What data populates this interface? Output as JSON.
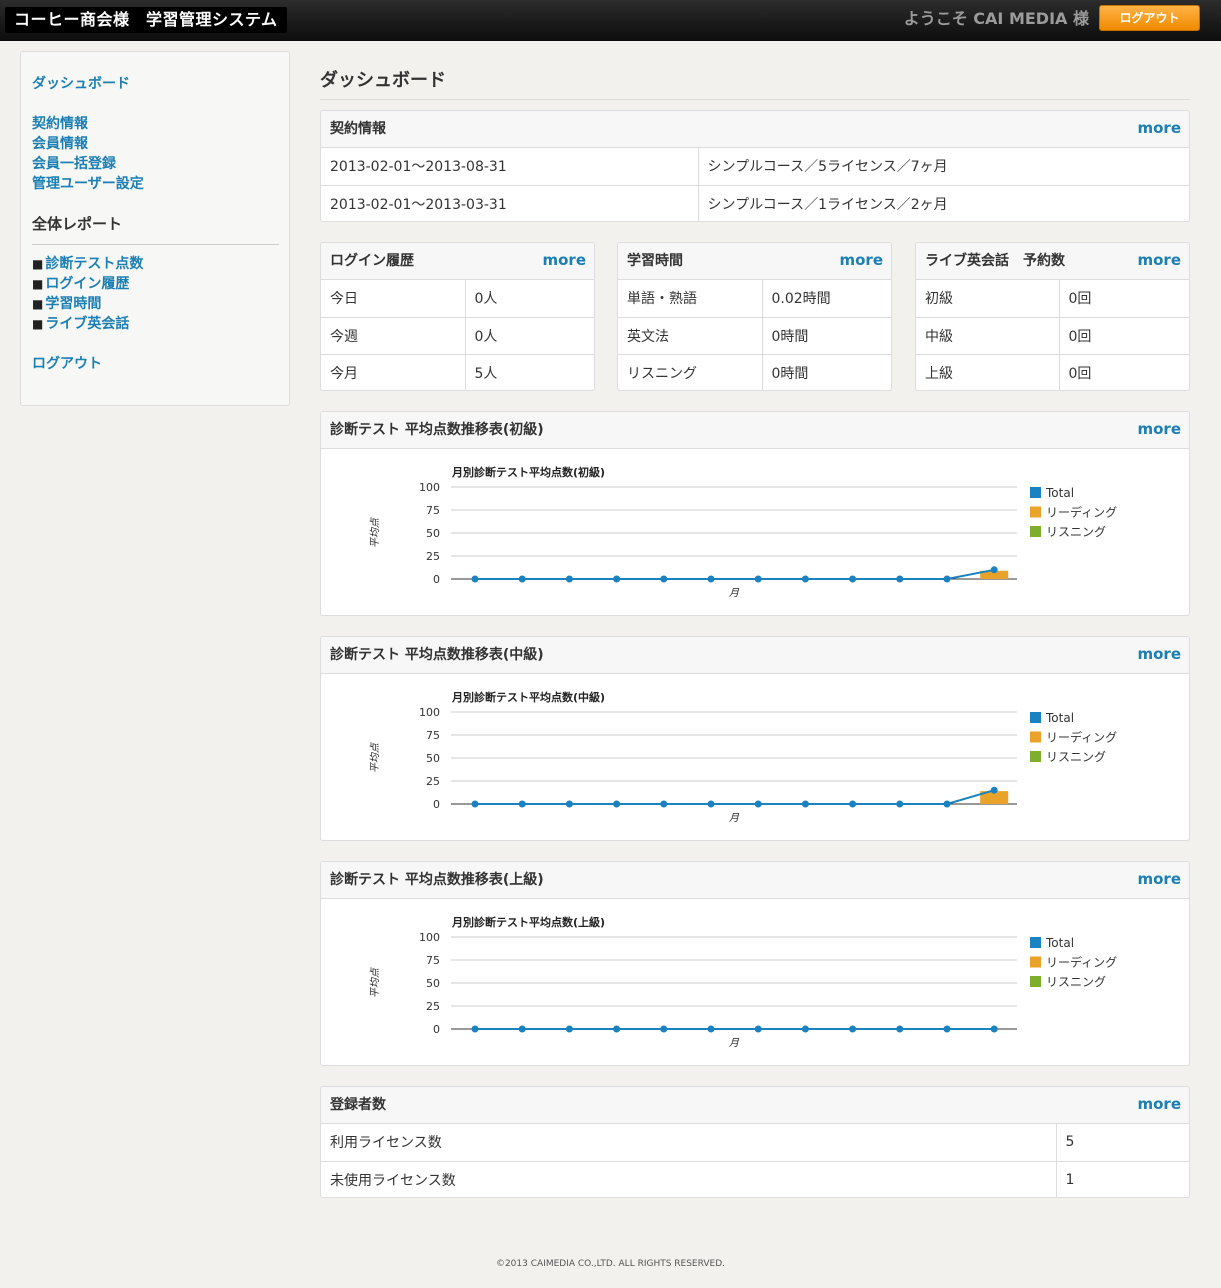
{
  "header": {
    "brand": "コーヒー商会様　学習管理システム",
    "welcome": "ようこそ CAI MEDIA 様",
    "logout_button": "ログアウト"
  },
  "sidebar": {
    "dashboard": "ダッシュボード",
    "links": [
      "契約情報",
      "会員情報",
      "会員一括登録",
      "管理ユーザー設定"
    ],
    "report_heading": "全体レポート",
    "bullet": "■",
    "reports": [
      "診断テスト点数",
      "ログイン履歴",
      "学習時間",
      "ライブ英会話"
    ],
    "logout": "ログアウト"
  },
  "main": {
    "title": "ダッシュボード",
    "more": "more",
    "contract": {
      "title": "契約情報",
      "rows": [
        [
          "2013-02-01～2013-08-31",
          "シンプルコース／5ライセンス／7ヶ月"
        ],
        [
          "2013-02-01～2013-03-31",
          "シンプルコース／1ライセンス／2ヶ月"
        ]
      ]
    },
    "login_history": {
      "title": "ログイン履歴",
      "rows": [
        [
          "今日",
          "0人"
        ],
        [
          "今週",
          "0人"
        ],
        [
          "今月",
          "5人"
        ]
      ]
    },
    "study_time": {
      "title": "学習時間",
      "rows": [
        [
          "単語・熟語",
          "0.02時間"
        ],
        [
          "英文法",
          "0時間"
        ],
        [
          "リスニング",
          "0時間"
        ]
      ]
    },
    "live_english": {
      "title": "ライブ英会話　予約数",
      "rows": [
        [
          "初級",
          "0回"
        ],
        [
          "中級",
          "0回"
        ],
        [
          "上級",
          "0回"
        ]
      ]
    },
    "registrations": {
      "title": "登録者数",
      "rows": [
        [
          "利用ライセンス数",
          "5"
        ],
        [
          "未使用ライセンス数",
          "1"
        ]
      ]
    }
  },
  "chart_panels": [
    {
      "panel_title": "診断テスト 平均点数推移表(初級)"
    },
    {
      "panel_title": "診断テスト 平均点数推移表(中級)"
    },
    {
      "panel_title": "診断テスト 平均点数推移表(上級)"
    }
  ],
  "chart_data": [
    {
      "type": "line",
      "title": "月別診断テスト平均点数(初級)",
      "xlabel": "月",
      "ylabel": "平均点",
      "ylim": [
        0,
        100
      ],
      "yticks": [
        0,
        25,
        50,
        75,
        100
      ],
      "grid": true,
      "legend_position": "right",
      "series": [
        {
          "name": "Total",
          "kind": "line",
          "color": "#1a82c0",
          "values": [
            0,
            0,
            0,
            0,
            0,
            0,
            0,
            0,
            0,
            0,
            0,
            10
          ]
        },
        {
          "name": "リーディング",
          "kind": "bar",
          "color": "#e9a32a",
          "values": [
            0,
            0,
            0,
            0,
            0,
            0,
            0,
            0,
            0,
            0,
            0,
            9
          ]
        },
        {
          "name": "リスニング",
          "kind": "bar",
          "color": "#7fae2e",
          "values": [
            0,
            0,
            0,
            0,
            0,
            0,
            0,
            0,
            0,
            0,
            0,
            0
          ]
        }
      ]
    },
    {
      "type": "line",
      "title": "月別診断テスト平均点数(中級)",
      "xlabel": "月",
      "ylabel": "平均点",
      "ylim": [
        0,
        100
      ],
      "yticks": [
        0,
        25,
        50,
        75,
        100
      ],
      "grid": true,
      "legend_position": "right",
      "series": [
        {
          "name": "Total",
          "kind": "line",
          "color": "#1a82c0",
          "values": [
            0,
            0,
            0,
            0,
            0,
            0,
            0,
            0,
            0,
            0,
            0,
            15
          ]
        },
        {
          "name": "リーディング",
          "kind": "bar",
          "color": "#e9a32a",
          "values": [
            0,
            0,
            0,
            0,
            0,
            0,
            0,
            0,
            0,
            0,
            0,
            14
          ]
        },
        {
          "name": "リスニング",
          "kind": "bar",
          "color": "#7fae2e",
          "values": [
            0,
            0,
            0,
            0,
            0,
            0,
            0,
            0,
            0,
            0,
            0,
            0
          ]
        }
      ]
    },
    {
      "type": "line",
      "title": "月別診断テスト平均点数(上級)",
      "xlabel": "月",
      "ylabel": "平均点",
      "ylim": [
        0,
        100
      ],
      "yticks": [
        0,
        25,
        50,
        75,
        100
      ],
      "grid": true,
      "legend_position": "right",
      "series": [
        {
          "name": "Total",
          "kind": "line",
          "color": "#1a82c0",
          "values": [
            0,
            0,
            0,
            0,
            0,
            0,
            0,
            0,
            0,
            0,
            0,
            0
          ]
        },
        {
          "name": "リーディング",
          "kind": "bar",
          "color": "#e9a32a",
          "values": [
            0,
            0,
            0,
            0,
            0,
            0,
            0,
            0,
            0,
            0,
            0,
            0
          ]
        },
        {
          "name": "リスニング",
          "kind": "bar",
          "color": "#7fae2e",
          "values": [
            0,
            0,
            0,
            0,
            0,
            0,
            0,
            0,
            0,
            0,
            0,
            0
          ]
        }
      ]
    }
  ],
  "footer": "©2013 CAIMEDIA CO.,LTD. ALL RIGHTS RESERVED."
}
